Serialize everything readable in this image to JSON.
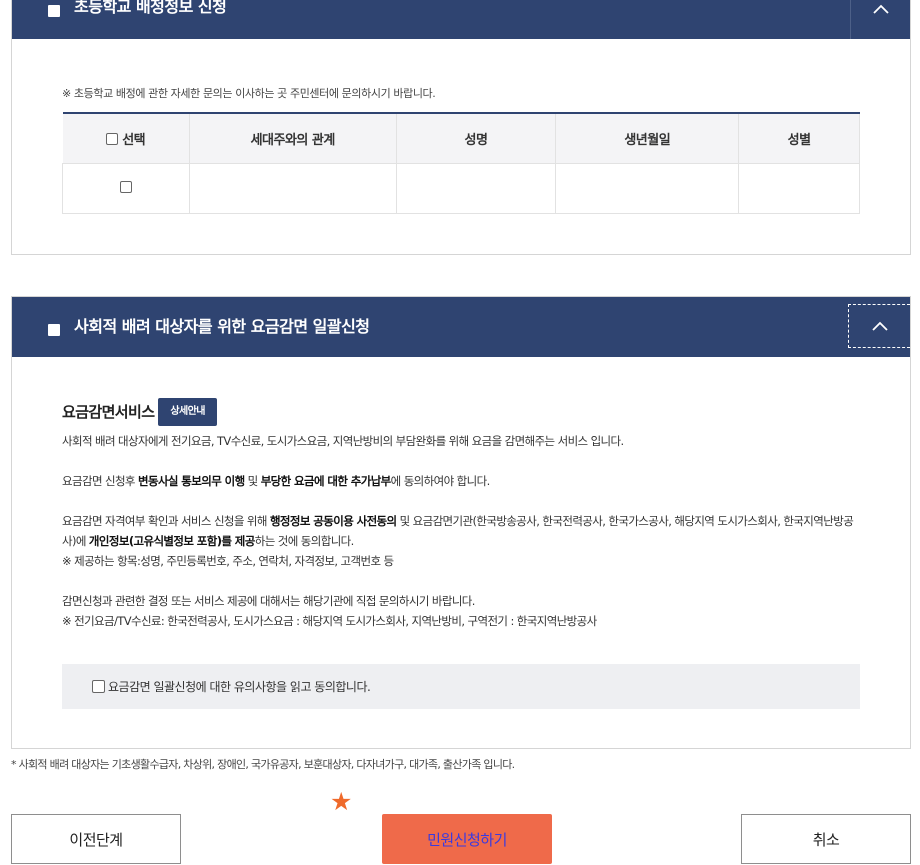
{
  "section1": {
    "title": "초등학교 배정정보 신청",
    "notice": "※ 초등학교 배정에 관한 자세한 문의는 이사하는 곳 주민센터에 문의하시기 바랍니다.",
    "table": {
      "headers": [
        "선택",
        "세대주와의 관계",
        "성명",
        "생년월일",
        "성별"
      ],
      "rows": [
        [
          "",
          "",
          "",
          ""
        ]
      ]
    }
  },
  "section2": {
    "title": "사회적 배려 대상자를 위한 요금감면 일괄신청",
    "service_title": "요금감면서비스",
    "detail_button": "상세안내",
    "para1": "사회적 배려 대상자에게 전기요금, TV수신료, 도시가스요금, 지역난방비의 부담완화를 위해 요금을 감면해주는 서비스 입니다.",
    "para2": {
      "p1": "요금감면 신청후 ",
      "b1": "변동사실 통보의무 이행",
      "p2": " 및 ",
      "b2": "부당한 요금에 대한 추가납부",
      "p3": "에 동의하여야 합니다."
    },
    "para3": {
      "p1": "요금감면 자격여부 확인과 서비스 신청을 위해 ",
      "b1": "행정정보 공동이용 사전동의",
      "p2": " 및 요금감면기관(한국방송공사, 한국전력공사, 한국가스공사, 해당지역 도시가스회사, 한국지역난방공사)에 ",
      "b2": "개인정보(고유식별정보 포함)를 제공",
      "p3": "하는 것에 동의합니다.",
      "note": "※ 제공하는 항목:성명, 주민등록번호, 주소, 연락처, 자격정보, 고객번호 등"
    },
    "para4": {
      "line1": "감면신청과 관련한 결정 또는 서비스 제공에 대해서는 해당기관에 직접 문의하시기 바랍니다.",
      "line2": "※ 전기요금/TV수신료: 한국전력공사, 도시가스요금 : 해당지역 도시가스회사, 지역난방비, 구역전기 : 한국지역난방공사"
    },
    "agree_label": "요금감면 일괄신청에 대한 유의사항을 읽고 동의합니다."
  },
  "footnote": "* 사회적 배려 대상자는 기초생활수급자, 차상위, 장애인, 국가유공자, 보훈대상자, 다자녀가구, 대가족, 출산가족 입니다.",
  "buttons": {
    "prev": "이전단계",
    "submit": "민원신청하기",
    "cancel": "취소"
  },
  "colors": {
    "header_bg": "#2f4471",
    "submit_bg": "#ef6a4a",
    "star": "#ef6a2b"
  },
  "icons": {
    "star": "★",
    "collapse": "chevron-up-icon"
  }
}
